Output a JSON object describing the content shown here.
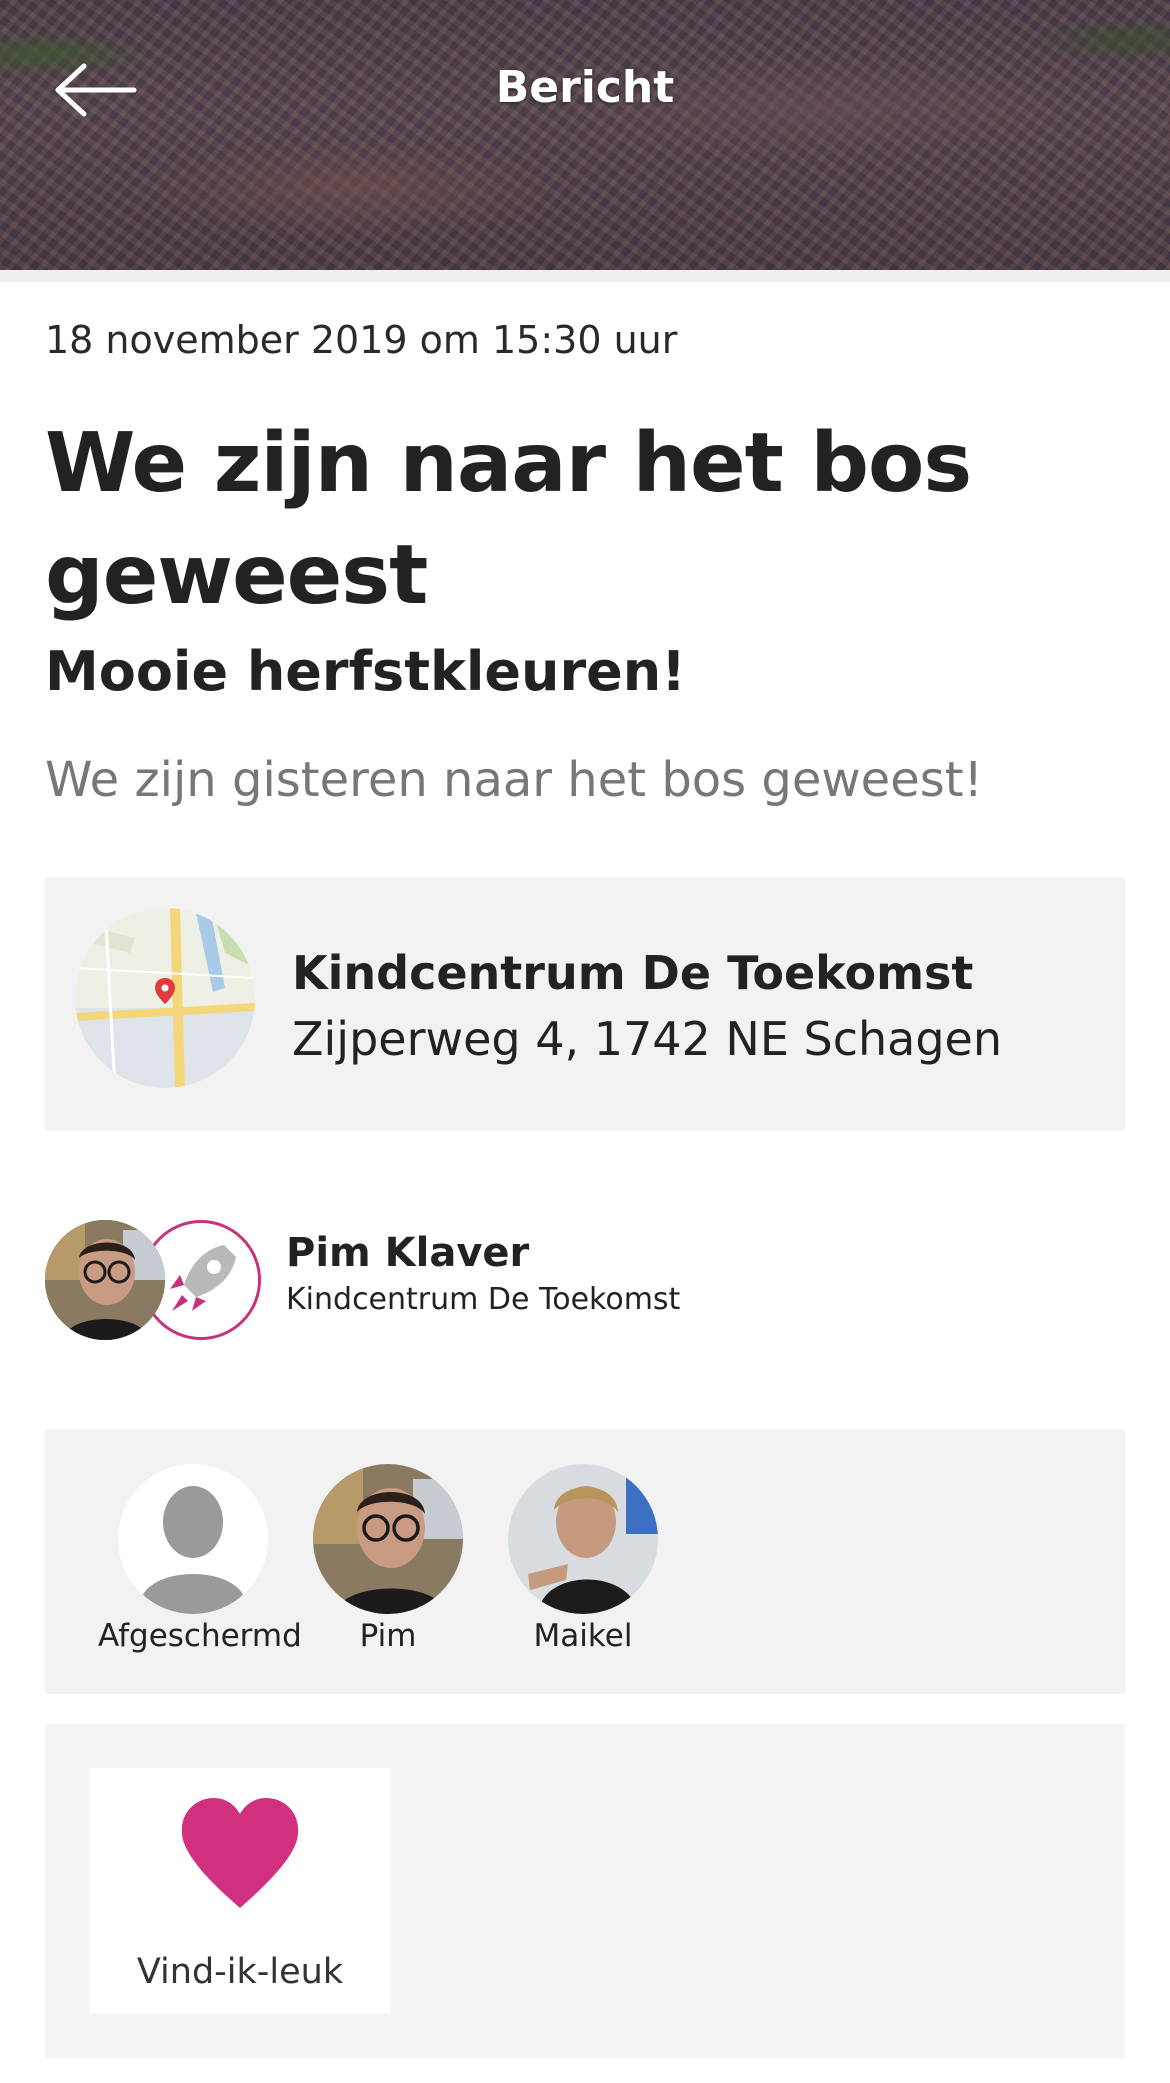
{
  "header": {
    "title": "Bericht",
    "back_icon": "arrow-left-icon",
    "background": "autumn forest path photo"
  },
  "post": {
    "date": "18 november 2019 om 15:30 uur",
    "title": "We zijn naar het bos geweest",
    "subtitle": "Mooie herfstkleuren!",
    "body": "We zijn gisteren naar het bos geweest!"
  },
  "location": {
    "name": "Kindcentrum De Toekomst",
    "address": "Zijperweg 4, 1742 NE Schagen",
    "map_icon": "map-pin-icon"
  },
  "author": {
    "name": "Pim Klaver",
    "organization": "Kindcentrum De Toekomst",
    "badge_icon": "rocket-icon"
  },
  "viewers": [
    {
      "name": "Afgeschermd",
      "avatar": "placeholder-person-icon"
    },
    {
      "name": "Pim",
      "avatar": "photo"
    },
    {
      "name": "Maikel",
      "avatar": "photo"
    }
  ],
  "reactions": {
    "like_label": "Vind-ik-leuk",
    "like_icon": "heart-icon"
  },
  "colors": {
    "accent": "#d0307f",
    "card_background": "#f2f2f2",
    "muted_text": "#777777"
  }
}
